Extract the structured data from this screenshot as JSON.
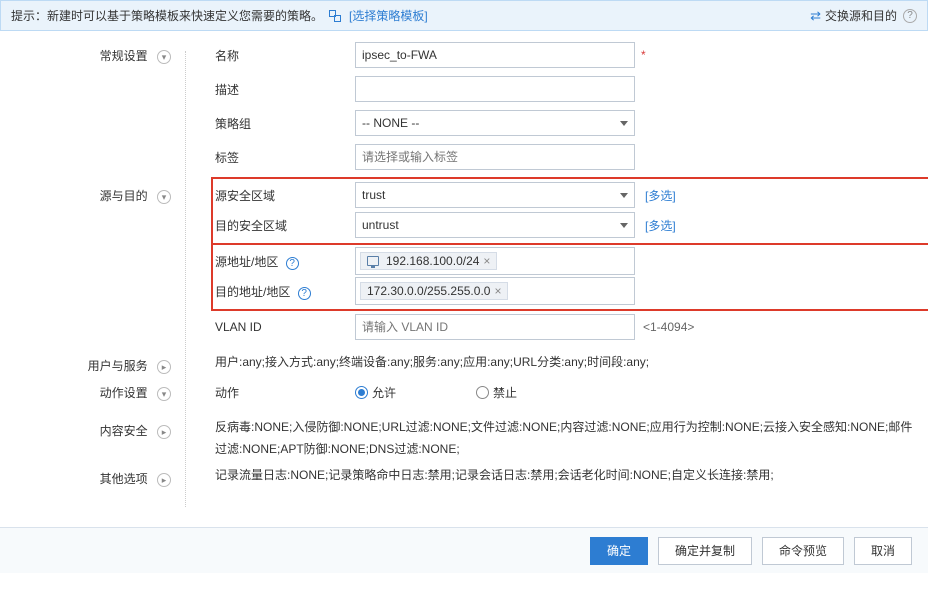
{
  "tip": {
    "text": "提示：新建时可以基于策略模板来快速定义您需要的策略。",
    "link": "[选择策略模板]",
    "swap": "交换源和目的"
  },
  "sections": {
    "general": "常规设置",
    "srcdst": "源与目的",
    "user": "用户与服务",
    "action": "动作设置",
    "content": "内容安全",
    "other": "其他选项"
  },
  "general": {
    "name_label": "名称",
    "name_value": "ipsec_to-FWA",
    "desc_label": "描述",
    "desc_value": "",
    "group_label": "策略组",
    "group_value": "-- NONE --",
    "tag_label": "标签",
    "tag_placeholder": "请选择或输入标签"
  },
  "srcdst": {
    "src_zone_label": "源安全区域",
    "src_zone_value": "trust",
    "dst_zone_label": "目的安全区域",
    "dst_zone_value": "untrust",
    "more": "[多选]",
    "src_addr_label": "源地址/地区",
    "src_addr_tag": "192.168.100.0/24",
    "dst_addr_label": "目的地址/地区",
    "dst_addr_tag": "172.30.0.0/255.255.0.0",
    "vlan_label": "VLAN ID",
    "vlan_placeholder": "请输入 VLAN ID",
    "vlan_hint": "<1-4094>"
  },
  "user_summary": "用户:any;接入方式:any;终端设备:any;服务:any;应用:any;URL分类:any;时间段:any;",
  "action": {
    "label": "动作",
    "allow": "允许",
    "deny": "禁止"
  },
  "content_summary": "反病毒:NONE;入侵防御:NONE;URL过滤:NONE;文件过滤:NONE;内容过滤:NONE;应用行为控制:NONE;云接入安全感知:NONE;邮件过滤:NONE;APT防御:NONE;DNS过滤:NONE;",
  "other_summary": "记录流量日志:NONE;记录策略命中日志:禁用;记录会话日志:禁用;会话老化时间:NONE;自定义长连接:禁用;",
  "footer": {
    "ok": "确定",
    "ok_copy": "确定并复制",
    "preview": "命令预览",
    "cancel": "取消"
  }
}
